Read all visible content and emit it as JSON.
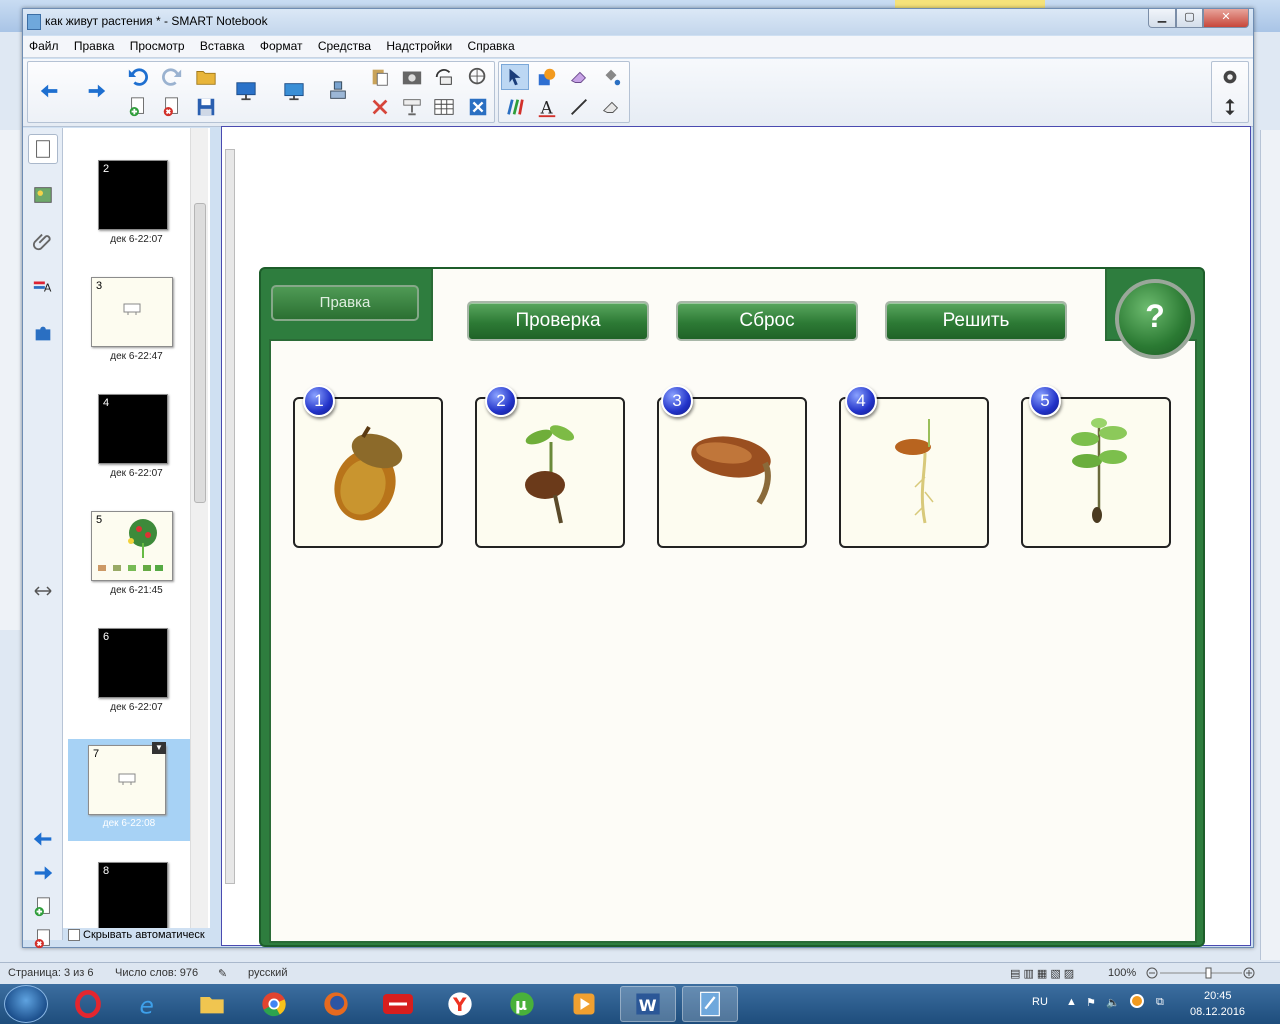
{
  "window": {
    "title": "как живут растения * - SMART Notebook"
  },
  "menu": [
    "Файл",
    "Правка",
    "Просмотр",
    "Вставка",
    "Формат",
    "Средства",
    "Надстройки",
    "Справка"
  ],
  "sorter": {
    "pages": [
      {
        "num": "2",
        "date": "дек 6-22:07",
        "style": "dark"
      },
      {
        "num": "3",
        "date": "дек 6-22:47",
        "style": "light"
      },
      {
        "num": "4",
        "date": "дек 6-22:07",
        "style": "dark"
      },
      {
        "num": "5",
        "date": "дек 6-21:45",
        "style": "light"
      },
      {
        "num": "6",
        "date": "дек 6-22:07",
        "style": "dark"
      },
      {
        "num": "7",
        "date": "дек 6-22:08",
        "style": "light"
      },
      {
        "num": "8",
        "date": "",
        "style": "dark"
      }
    ],
    "autohide_label": "Скрывать автоматическ"
  },
  "activity": {
    "edit_label": "Правка",
    "check_label": "Проверка",
    "reset_label": "Сброс",
    "solve_label": "Решить",
    "help_label": "?",
    "cards": [
      {
        "badge": "1",
        "image": "acorn"
      },
      {
        "badge": "2",
        "image": "seedling-on-acorn"
      },
      {
        "badge": "3",
        "image": "sprouting-acorn"
      },
      {
        "badge": "4",
        "image": "acorn-with-root"
      },
      {
        "badge": "5",
        "image": "young-oak"
      }
    ]
  },
  "statusbar": {
    "page": "Страница: 3 из 6",
    "words": "Число слов: 976",
    "lang": "русский",
    "zoom": "100%"
  },
  "tray": {
    "lang": "RU",
    "time": "20:45",
    "date": "08.12.2016"
  }
}
